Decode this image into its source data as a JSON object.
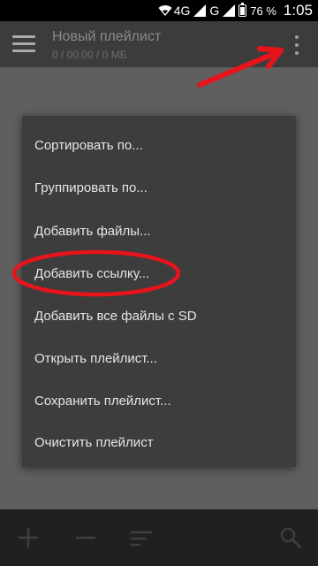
{
  "status": {
    "network": "4G",
    "network2": "G",
    "battery_percent": "76 %",
    "battery_level": 0.76,
    "time": "1:05"
  },
  "appbar": {
    "title": "Новый плейлист",
    "subtitle": "0 / 00:00 / 0 МБ"
  },
  "menu": {
    "items": [
      {
        "label": "Сортировать по..."
      },
      {
        "label": "Группировать по..."
      },
      {
        "label": "Добавить файлы..."
      },
      {
        "label": "Добавить ссылку..."
      },
      {
        "label": "Добавить все файлы с SD"
      },
      {
        "label": "Открыть плейлист..."
      },
      {
        "label": "Сохранить плейлист..."
      },
      {
        "label": "Очистить плейлист"
      }
    ]
  },
  "colors": {
    "annotation": "#e8141c"
  }
}
